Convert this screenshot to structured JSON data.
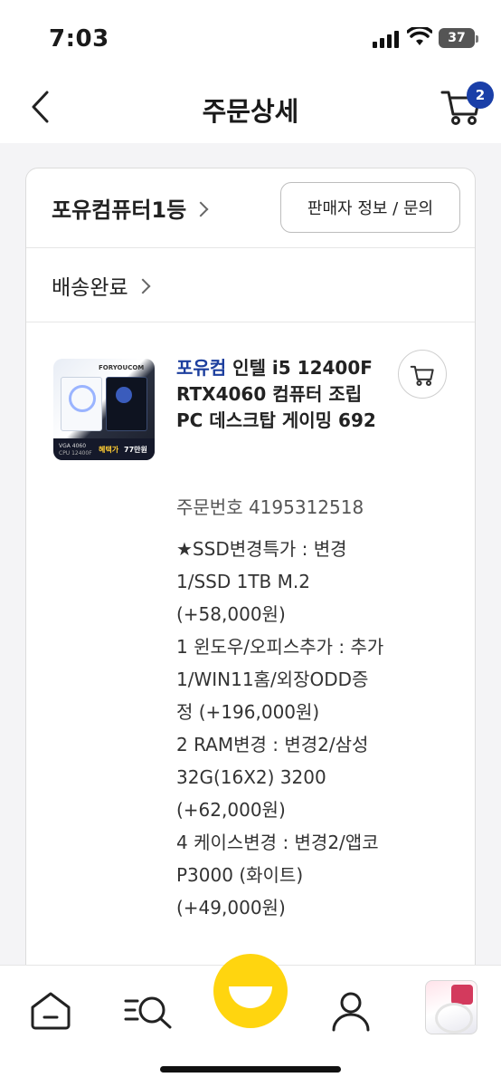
{
  "status_bar": {
    "time": "7:03",
    "battery": "37"
  },
  "header": {
    "title": "주문상세",
    "cart_count": "2"
  },
  "order": {
    "seller_name": "포유컴퓨터1등",
    "seller_button": "판매자 정보 / 문의",
    "status": "배송완료"
  },
  "product": {
    "title_brand": "포유컴",
    "title_rest": " 인텔 i5 12400F RTX4060 컴퓨터 조립PC 데스크탑 게이밍 692",
    "order_number": "주문번호 4195312518",
    "thumbnail": {
      "brand": "FORYOUCOM",
      "line1": "VGA 4060",
      "line2": "CPU 12400F",
      "price_label": "혜택가",
      "price": "77만원"
    },
    "options": [
      "★SSD변경특가 : 변경1/SSD 1TB M.2 (+58,000원)",
      "1 윈도우/오피스추가 : 추가1/WIN11홈/외장ODD증정 (+196,000원)",
      "2 RAM변경 : 변경2/삼성32G(16X2) 3200 (+62,000원)",
      "4 케이스변경 : 변경2/앱코 P3000 (화이트) (+49,000원)"
    ]
  },
  "bottom_nav": {
    "items": [
      "home",
      "search",
      "center",
      "my",
      "recent"
    ]
  },
  "colors": {
    "accent": "#1a3fa8",
    "brand_link": "#1d3f9e",
    "center_button": "#ffd50f"
  }
}
